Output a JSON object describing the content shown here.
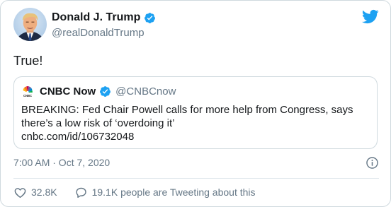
{
  "colors": {
    "twitter_blue": "#1da1f2",
    "text_primary": "#14171a",
    "text_secondary": "#657786",
    "border": "#cfd9de"
  },
  "author": {
    "name": "Donald J. Trump",
    "handle": "@realDonaldTrump",
    "verified": true,
    "avatar_icon": "profile-photo"
  },
  "brand_icon": "twitter-bird-icon",
  "tweet": {
    "text": "True!",
    "timestamp": "7:00 AM · Oct 7, 2020"
  },
  "quoted_tweet": {
    "name": "CNBC Now",
    "handle": "@CNBCnow",
    "verified": true,
    "avatar_icon": "cnbc-peacock-logo",
    "text": "BREAKING: Fed Chair Powell calls for more help from Congress, says there’s a low risk of ‘overdoing it’",
    "link": "cnbc.com/id/106732048"
  },
  "actions": {
    "likes": "32.8K",
    "conversation": "19.1K people are Tweeting about this"
  },
  "icons": {
    "verified": "verified-badge-icon",
    "info": "info-icon",
    "like": "heart-icon",
    "reply": "speech-bubble-icon"
  }
}
